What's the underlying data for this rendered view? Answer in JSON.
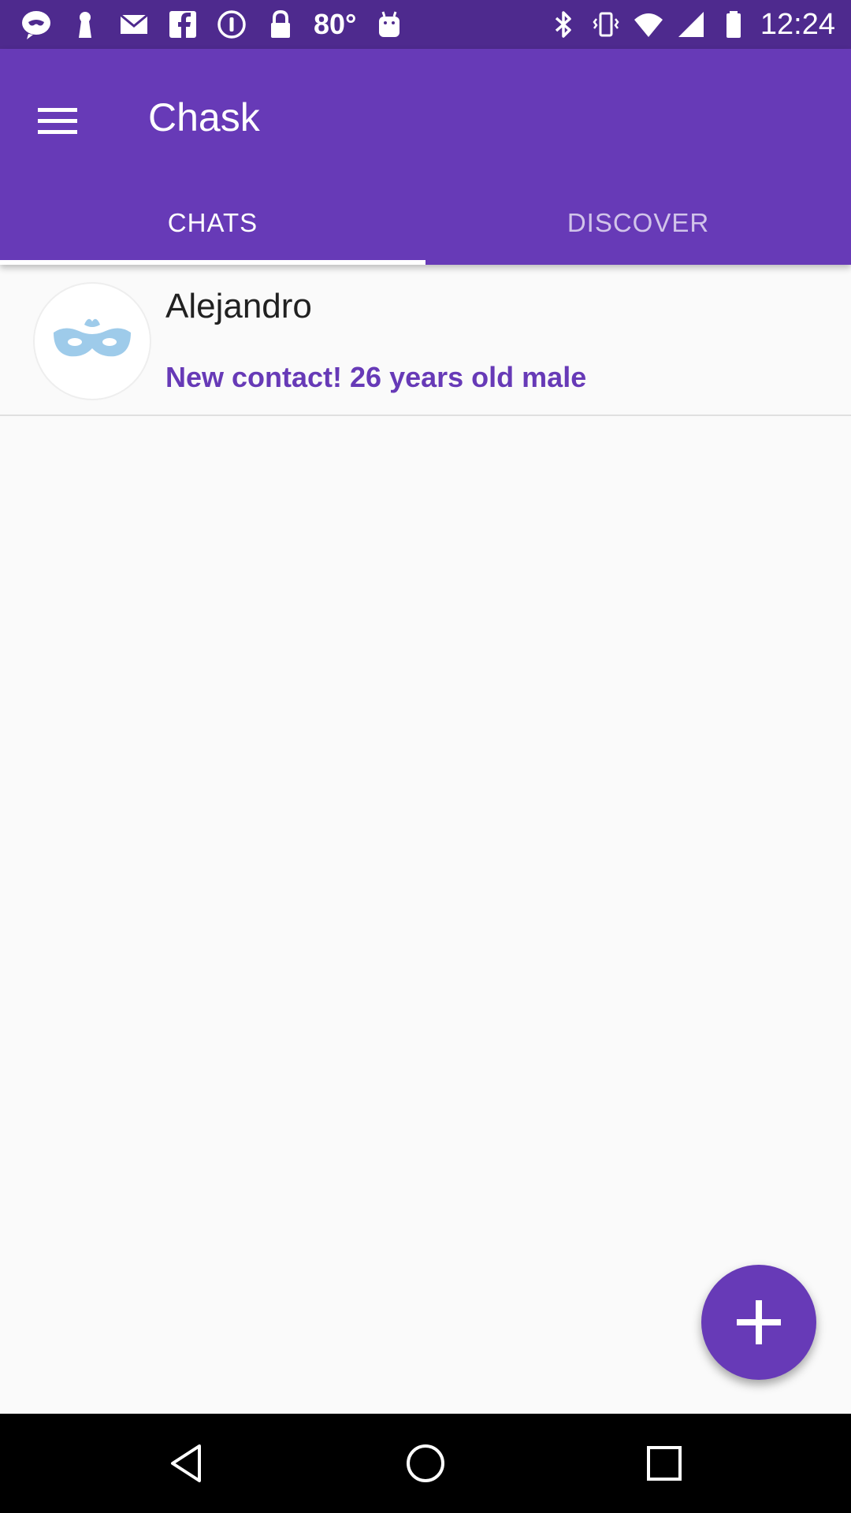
{
  "status_bar": {
    "left_icons": [
      "chat-mask-icon",
      "keyhole-icon",
      "mail-icon",
      "facebook-icon",
      "info-icon",
      "lock-icon"
    ],
    "temperature": "80°",
    "extra_icon": "android-icon",
    "right_icons": [
      "bluetooth-icon",
      "vibrate-icon",
      "wifi-icon",
      "signal-icon",
      "battery-icon"
    ],
    "time": "12:24"
  },
  "app_bar": {
    "title": "Chask",
    "menu_icon": "hamburger-menu-icon"
  },
  "tabs": [
    {
      "label": "CHATS",
      "active": true
    },
    {
      "label": "DISCOVER",
      "active": false
    }
  ],
  "chats": [
    {
      "name": "Alejandro",
      "subtitle": "New contact! 26 years old male",
      "avatar_icon": "mask-icon"
    }
  ],
  "fab": {
    "icon": "plus-icon"
  },
  "nav_bar": {
    "buttons": [
      "back-icon",
      "home-icon",
      "recents-icon"
    ]
  },
  "colors": {
    "primary": "#673ab7",
    "primary_dark": "#4e2a8e",
    "accent_text": "#673ab7",
    "avatar_mask": "#9ecbea"
  }
}
